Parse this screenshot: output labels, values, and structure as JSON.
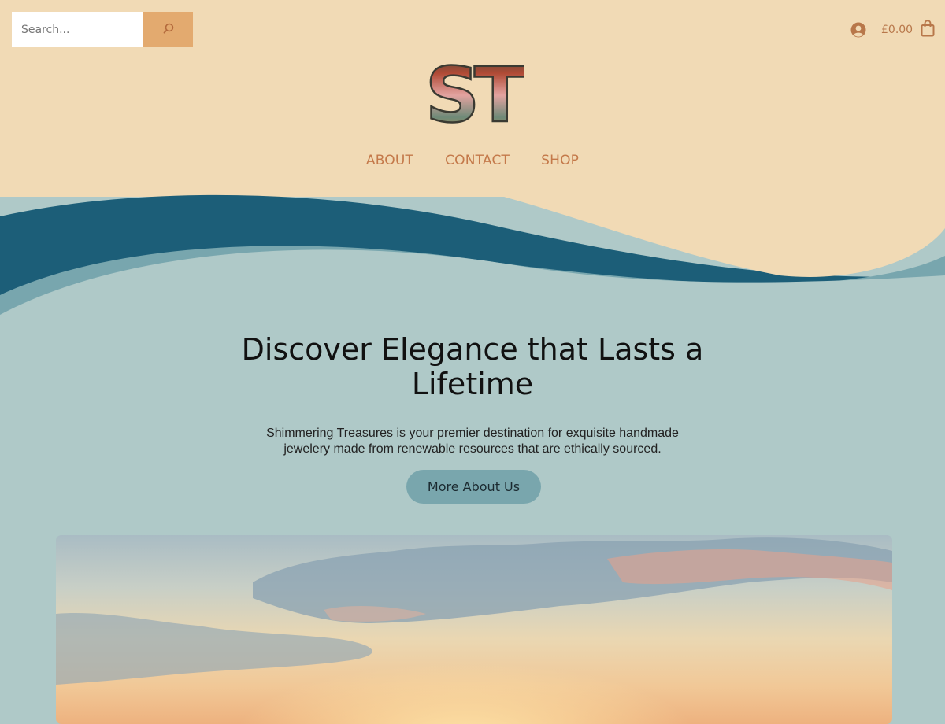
{
  "search": {
    "placeholder": "Search...",
    "button_icon": "search-icon"
  },
  "header": {
    "account_icon": "account-icon",
    "cart_total": "£0.00",
    "cart_icon": "shopping-bag-icon",
    "logo_text": "ST"
  },
  "nav": {
    "items": [
      {
        "label": "ABOUT"
      },
      {
        "label": "CONTACT"
      },
      {
        "label": "SHOP"
      }
    ]
  },
  "hero": {
    "title": "Discover Elegance that Lasts a Lifetime",
    "description": "Shimmering Treasures is your premier destination for exquisite handmade jewelery made from renewable resources that are ethically sourced.",
    "button_label": "More About Us"
  },
  "colors": {
    "header_bg": "#f1dab5",
    "body_bg": "#afc9c8",
    "wave_dark": "#1c5e78",
    "wave_mid": "#78a6ae",
    "accent": "#e3aa6f",
    "nav_text": "#c4794a",
    "button_bg": "#79a6ad"
  }
}
